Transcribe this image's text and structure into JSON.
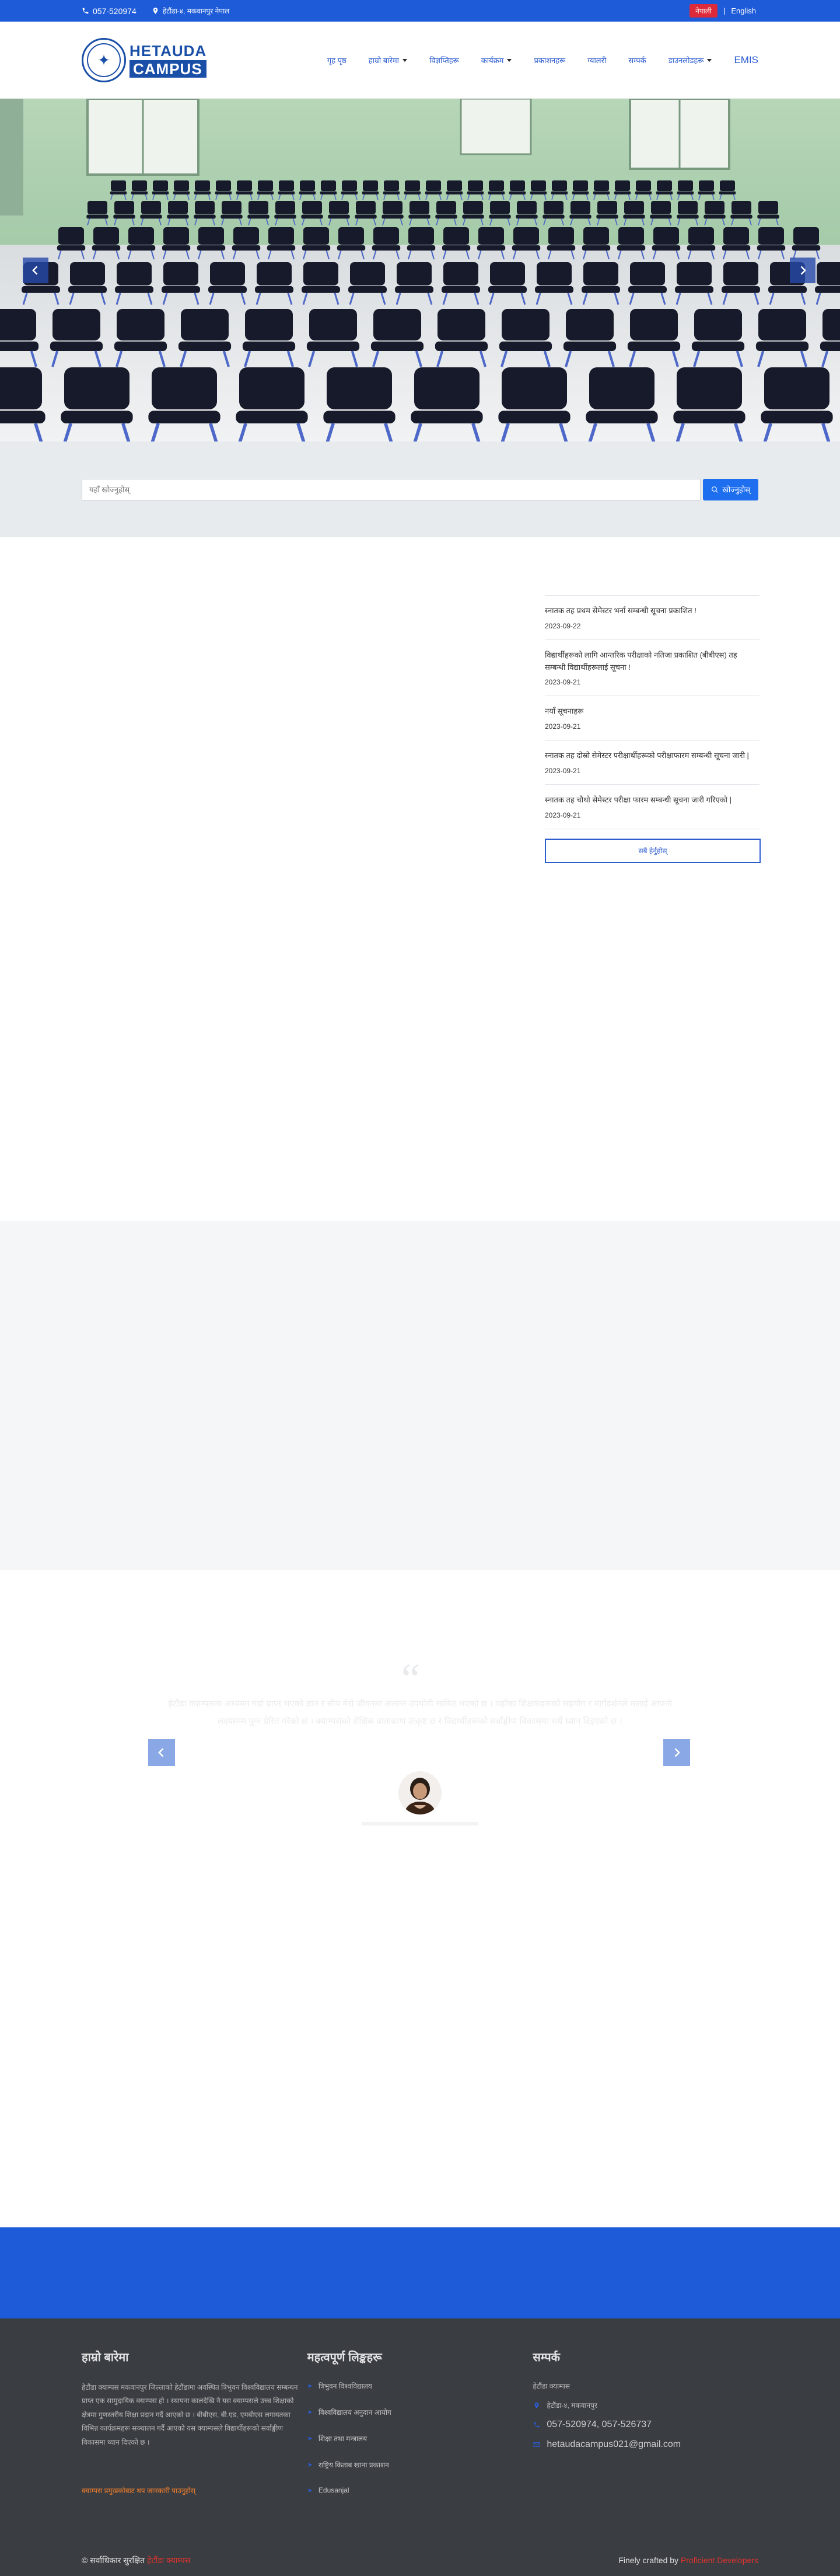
{
  "topbar": {
    "phone": "057-520974",
    "address": "हेटौंडा-४, मकवानपुर नेपाल",
    "lang_active": "नेपाली",
    "lang_sep": "|",
    "lang_other": "English"
  },
  "header": {
    "logo_line1": "HETAUDA",
    "logo_line2": "CAMPUS",
    "nav": [
      {
        "label": "गृह पृष्ठ",
        "dropdown": false
      },
      {
        "label": "हाम्रो बारेमा",
        "dropdown": true
      },
      {
        "label": "विज्ञप्तिहरू",
        "dropdown": false
      },
      {
        "label": "कार्यक्रम",
        "dropdown": true
      },
      {
        "label": "प्रकाशनहरू",
        "dropdown": false
      },
      {
        "label": "ग्यालरी",
        "dropdown": false
      },
      {
        "label": "सम्पर्क",
        "dropdown": false
      },
      {
        "label": "डाउनलोडहरू",
        "dropdown": true
      },
      {
        "label": "EMIS",
        "dropdown": false
      }
    ]
  },
  "search": {
    "placeholder": "यहाँ खोज्नुहोस्",
    "button": "खोज्नुहोस्"
  },
  "news": {
    "items": [
      {
        "title": "स्नातक तह प्रथम सेमेस्टर भर्ना सम्बन्धी सूचना प्रकाशित !",
        "date": "2023-09-22"
      },
      {
        "title": "विद्यार्थीहरूको लागि आन्तरिक परीक्षाको नतिजा प्रकाशित (बीबीएस) तह सम्बन्धी विद्यार्थीहरूलाई सूचना !",
        "date": "2023-09-21"
      },
      {
        "title": "नयाँ सूचनाहरू",
        "date": "2023-09-21"
      },
      {
        "title": "स्नातक तह दोस्रो सेमेस्टर परीक्षार्थीहरूको परीक्षाफारम सम्बन्धी सूचना जारी |",
        "date": "2023-09-21"
      },
      {
        "title": "स्नातक तह चौथो सेमेस्टर परीक्षा फारम सम्बन्धी सूचना जारी गरिएको |",
        "date": "2023-09-21"
      }
    ],
    "view_all": "सबै हेर्नुहोस्"
  },
  "testimonial": {
    "quote_mark": "“",
    "text": "हेटौंडा क्याम्पसमा अध्ययन गर्दा प्राप्त भएको ज्ञान र सीप मेरो जीवनमा अत्यन्त उपयोगी साबित भएको छ । यहाँका शिक्षकहरूको सहयोग र मार्गदर्शनले मलाई आफ्नो लक्ष्यसम्म पुग्न प्रेरित गरेको छ । क्याम्पसको शैक्षिक वातावरण उत्कृष्ट छ र विद्यार्थीहरूको सर्वाङ्गीण विकासमा सधैं ध्यान दिइएको छ ।"
  },
  "footer": {
    "about_title": "हाम्रो बारेमा",
    "about_text": "हेटौंडा क्याम्पस मकवानपुर जिल्लाको हेटौंडामा अवस्थित त्रिभुवन विश्वविद्यालय सम्बन्धन प्राप्त एक सामुदायिक क्याम्पस हो । स्थापना कालदेखि नै यस क्याम्पसले उच्च शिक्षाको क्षेत्रमा गुणस्तरीय शिक्षा प्रदान गर्दै आएको छ । बीबीएस, बी.एड, एमबीएस लगायतका विभिन्न कार्यक्रमहरू सञ्चालन गर्दै आएको यस क्याम्पसले विद्यार्थीहरूको सर्वाङ्गीण विकासमा ध्यान दिएको छ ।",
    "about_more": "क्याम्पस प्रमुखकोबाट थप जानकारी पाउनुहोस्",
    "links_title": "महत्वपूर्ण लिङ्कहरू",
    "links": [
      "त्रिभुवन विश्वविद्यालय",
      "विश्वविद्यालय अनुदान आयोग",
      "शिक्षा तथा मन्त्रालय",
      "राष्ट्रिय किताब खाना प्रकाशन",
      "Edusanjal"
    ],
    "contact_title": "सम्पर्क",
    "contact": {
      "name": "हेटौंडा क्याम्पस",
      "address": "हेटौंडा-४, मकवानपुर",
      "phone": "057-520974, 057-526737",
      "email": "hetaudacampus021@gmail.com"
    },
    "copyright_prefix": "© सर्वाधिकार सुरक्षित",
    "copyright_name": "हेटौंडा क्याम्पस",
    "credit_prefix": "Finely crafted by",
    "credit_name": "Proficient Developers"
  },
  "colors": {
    "primary_blue": "#1d5bd8",
    "lang_red": "#dc2a3a",
    "footer_bg": "#3a3d42",
    "accent_orange": "#ef7d2b"
  }
}
